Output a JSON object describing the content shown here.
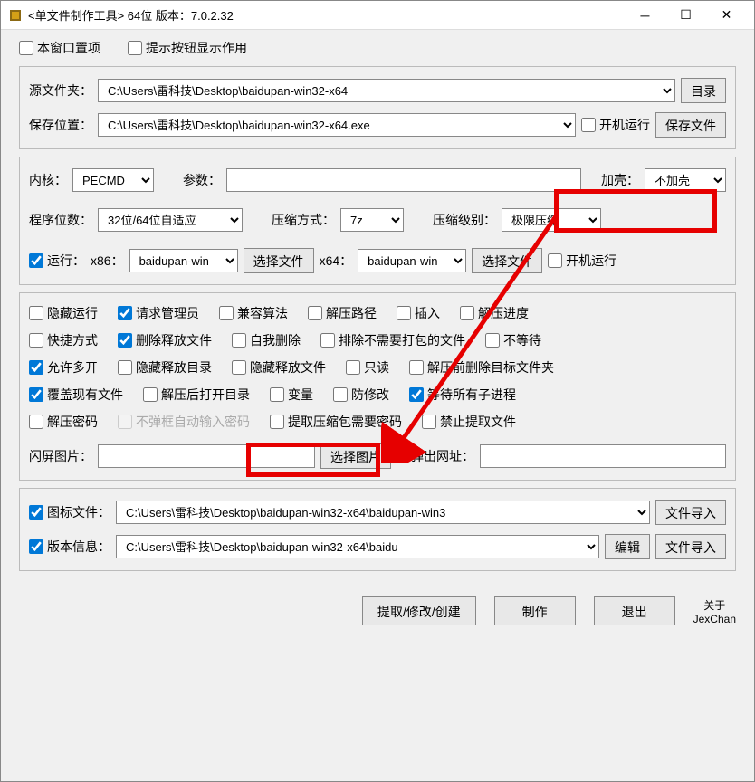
{
  "title": "<单文件制作工具> 64位 版本：7.0.2.32",
  "topchecks": {
    "pin": "本窗口置项",
    "hint": "提示按钮显示作用"
  },
  "p1": {
    "src_label": "源文件夹：",
    "src_value": "C:\\Users\\雷科技\\Desktop\\baidupan-win32-x64",
    "src_btn": "目录",
    "save_label": "保存位置：",
    "save_value": "C:\\Users\\雷科技\\Desktop\\baidupan-win32-x64.exe",
    "boot": "开机运行",
    "save_btn": "保存文件"
  },
  "p2": {
    "kernel_label": "内核：",
    "kernel_value": "PECMD",
    "param_label": "参数：",
    "param_value": "",
    "shell_label": "加壳：",
    "shell_value": "不加壳",
    "bits_label": "程序位数：",
    "bits_value": "32位/64位自适应",
    "comp_label": "压缩方式：",
    "comp_value": "7z",
    "level_label": "压缩级别：",
    "level_value": "极限压缩",
    "run_label": "运行：",
    "x86_label": "x86：",
    "x86_value": "baidupan-win",
    "sel_file": "选择文件",
    "x64_label": "x64：",
    "x64_value": "baidupan-win",
    "boot": "开机运行"
  },
  "p3": {
    "c1": "隐藏运行",
    "c2": "请求管理员",
    "c3": "兼容算法",
    "c4": "解压路径",
    "c5": "插入",
    "c6": "解压进度",
    "c7": "快捷方式",
    "c8": "删除释放文件",
    "c9": "自我删除",
    "c10": "排除不需要打包的文件",
    "c11": "不等待",
    "c12": "允许多开",
    "c13": "隐藏释放目录",
    "c14": "隐藏释放文件",
    "c15": "只读",
    "c16": "解压前删除目标文件夹",
    "c17": "覆盖现有文件",
    "c18": "解压后打开目录",
    "c19": "变量",
    "c20": "防修改",
    "c21": "等待所有子进程",
    "c22": "解压密码",
    "c23": "不弹框自动输入密码",
    "c24": "提取压缩包需要密码",
    "c25": "禁止提取文件",
    "splash_label": "闪屏图片：",
    "splash_btn": "选择图片",
    "popup_label": "弹出网址："
  },
  "p4": {
    "icon_label": "图标文件：",
    "icon_value": "C:\\Users\\雷科技\\Desktop\\baidupan-win32-x64\\baidupan-win3",
    "icon_btn": "文件导入",
    "ver_label": "版本信息：",
    "ver_value": "C:\\Users\\雷科技\\Desktop\\baidupan-win32-x64\\baidu",
    "ver_edit": "编辑",
    "ver_btn": "文件导入"
  },
  "footer": {
    "b1": "提取/修改/创建",
    "b2": "制作",
    "b3": "退出",
    "about1": "关于",
    "about2": "JexChan"
  }
}
